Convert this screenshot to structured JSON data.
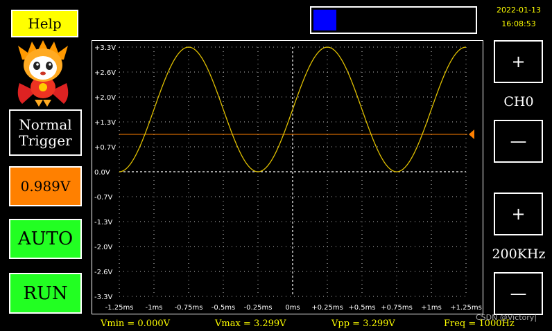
{
  "help_label": "Help",
  "progress": {
    "fill_fraction": 0.14,
    "color": "#0000ff"
  },
  "datetime": {
    "date": "2022-01-13",
    "time": "16:08:53"
  },
  "buttons": {
    "trigger_mode_line1": "Normal",
    "trigger_mode_line2": "Trigger",
    "trigger_level": "0.989V",
    "auto": "AUTO",
    "run": "RUN"
  },
  "channel": {
    "plus": "+",
    "label": "CH0",
    "minus": "—"
  },
  "timebase": {
    "plus": "+",
    "label": "200KHz",
    "minus": "—"
  },
  "chart_data": {
    "type": "line",
    "y_ticks": [
      "+3.3V",
      "+2.6V",
      "+2.0V",
      "+1.3V",
      "+0.7V",
      "0.0V",
      "-0.7V",
      "-1.3V",
      "-2.0V",
      "-2.6V",
      "-3.3V"
    ],
    "x_ticks": [
      "-1.25ms",
      "-1ms",
      "-0.75ms",
      "-0.5ms",
      "-0.25ms",
      "0ms",
      "+0.25ms",
      "+0.5ms",
      "+0.75ms",
      "+1ms",
      "+1.25ms"
    ],
    "ylim": [
      -3.3,
      3.3
    ],
    "xlim": [
      -1.25,
      1.25
    ],
    "grid": true,
    "series": [
      {
        "wave": "sine",
        "amplitude_v": 1.6495,
        "offset_v": 1.6495,
        "freq_hz": 1000,
        "phase_ms": 0,
        "color": "#e0c000"
      }
    ],
    "trigger_level_v": 0.989,
    "trigger_color": "#ff8000"
  },
  "stats": {
    "vmin": "Vmin = 0.000V",
    "vmax": "Vmax = 3.299V",
    "vpp": "Vpp = 3.299V",
    "freq": "Freq = 1000Hz"
  },
  "watermark": "CSDN @Victory|"
}
